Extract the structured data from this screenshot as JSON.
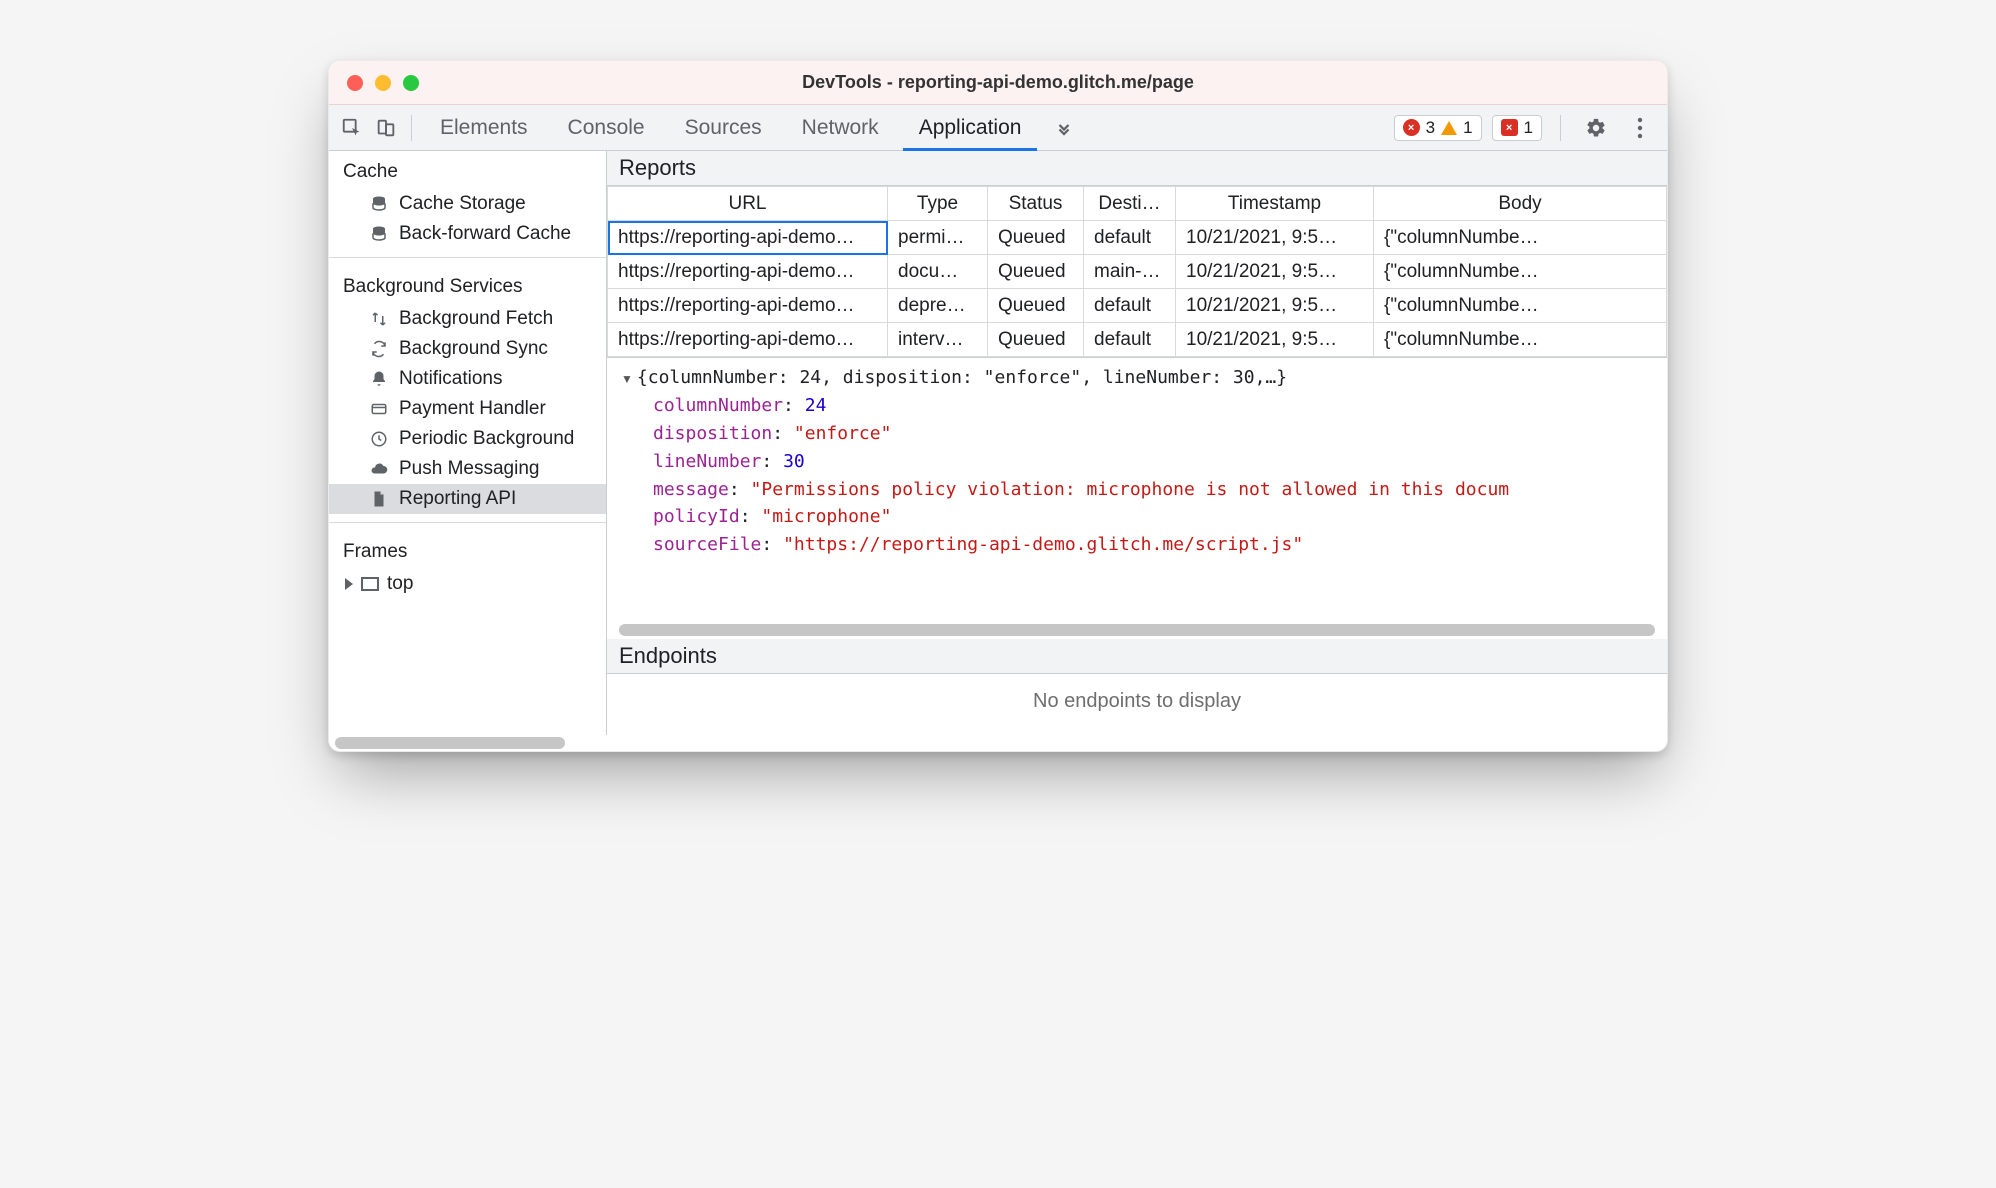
{
  "window": {
    "title": "DevTools - reporting-api-demo.glitch.me/page"
  },
  "tabs": {
    "elements": "Elements",
    "console": "Console",
    "sources": "Sources",
    "network": "Network",
    "application": "Application"
  },
  "badges": {
    "errors": "3",
    "warnings": "1",
    "issues": "1"
  },
  "sidebar": {
    "cache_title": "Cache",
    "cache_storage": "Cache Storage",
    "back_forward": "Back-forward Cache",
    "bgservices_title": "Background Services",
    "bg_fetch": "Background Fetch",
    "bg_sync": "Background Sync",
    "notifications": "Notifications",
    "payment": "Payment Handler",
    "periodic": "Periodic Background",
    "push": "Push Messaging",
    "reporting": "Reporting API",
    "frames_title": "Frames",
    "frames_top": "top"
  },
  "reports": {
    "title": "Reports",
    "headers": {
      "url": "URL",
      "type": "Type",
      "status": "Status",
      "destination": "Desti…",
      "timestamp": "Timestamp",
      "body": "Body"
    },
    "rows": [
      {
        "url": "https://reporting-api-demo…",
        "type": "permi…",
        "status": "Queued",
        "destination": "default",
        "timestamp": "10/21/2021, 9:5…",
        "body": "{\"columnNumbe…"
      },
      {
        "url": "https://reporting-api-demo…",
        "type": "docu…",
        "status": "Queued",
        "destination": "main-…",
        "timestamp": "10/21/2021, 9:5…",
        "body": "{\"columnNumbe…"
      },
      {
        "url": "https://reporting-api-demo…",
        "type": "depre…",
        "status": "Queued",
        "destination": "default",
        "timestamp": "10/21/2021, 9:5…",
        "body": "{\"columnNumbe…"
      },
      {
        "url": "https://reporting-api-demo…",
        "type": "interv…",
        "status": "Queued",
        "destination": "default",
        "timestamp": "10/21/2021, 9:5…",
        "body": "{\"columnNumbe…"
      }
    ]
  },
  "detail": {
    "summary": "{columnNumber: 24, disposition: \"enforce\", lineNumber: 30,…}",
    "columnNumber_key": "columnNumber",
    "columnNumber_val": "24",
    "disposition_key": "disposition",
    "disposition_val": "\"enforce\"",
    "lineNumber_key": "lineNumber",
    "lineNumber_val": "30",
    "message_key": "message",
    "message_val": "\"Permissions policy violation: microphone is not allowed in this docum",
    "policyId_key": "policyId",
    "policyId_val": "\"microphone\"",
    "sourceFile_key": "sourceFile",
    "sourceFile_val": "\"https://reporting-api-demo.glitch.me/script.js\""
  },
  "endpoints": {
    "title": "Endpoints",
    "empty": "No endpoints to display"
  }
}
